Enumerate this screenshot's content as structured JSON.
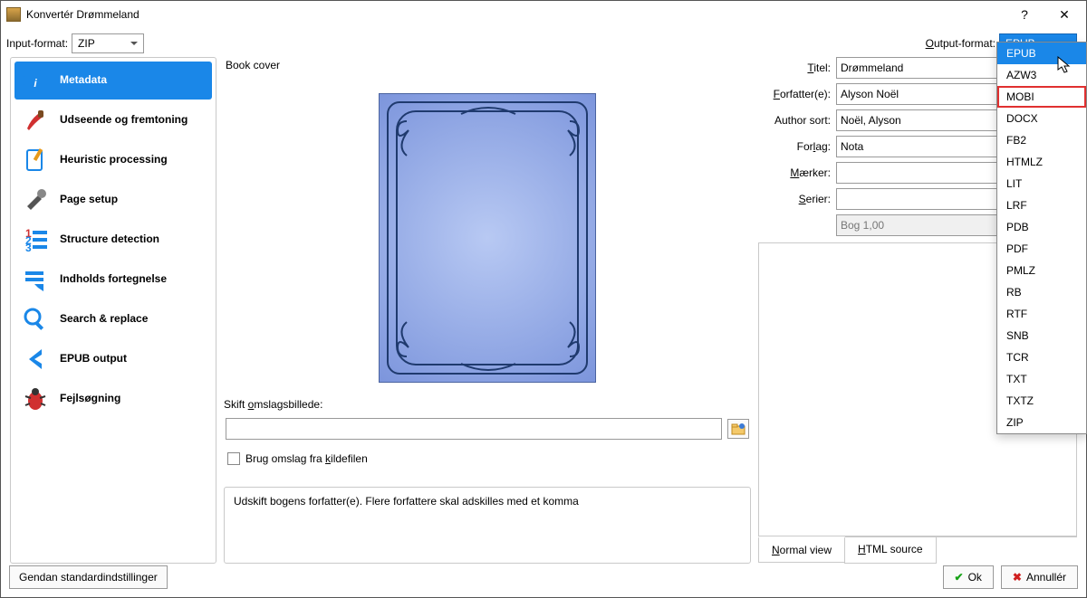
{
  "window": {
    "title": "Konvertér Drømmeland"
  },
  "input_format": {
    "label": "Input-format:",
    "value": "ZIP"
  },
  "output_format": {
    "label": "Output-format:",
    "value": "EPUB",
    "options": [
      "EPUB",
      "AZW3",
      "MOBI",
      "DOCX",
      "FB2",
      "HTMLZ",
      "LIT",
      "LRF",
      "PDB",
      "PDF",
      "PMLZ",
      "RB",
      "RTF",
      "SNB",
      "TCR",
      "TXT",
      "TXTZ",
      "ZIP"
    ],
    "selected": "EPUB",
    "highlighted": "MOBI"
  },
  "sidebar": {
    "items": [
      {
        "label": "Metadata",
        "icon": "info-icon",
        "active": true
      },
      {
        "label": "Udseende og fremtoning",
        "icon": "brush-icon"
      },
      {
        "label": "Heuristic processing",
        "icon": "wand-icon"
      },
      {
        "label": "Page setup",
        "icon": "tools-icon"
      },
      {
        "label": "Structure detection",
        "icon": "list-icon"
      },
      {
        "label": "Indholds fortegnelse",
        "icon": "toc-icon"
      },
      {
        "label": "Search & replace",
        "icon": "search-icon"
      },
      {
        "label": "EPUB output",
        "icon": "chevron-left-icon"
      },
      {
        "label": "Fejlsøgning",
        "icon": "bug-icon"
      }
    ]
  },
  "cover": {
    "heading": "Book cover",
    "change_label": "Skift omslagsbillede:",
    "use_source_cover": "Brug omslag fra kildefilen"
  },
  "form": {
    "title": {
      "label": "Titel:",
      "value": "Drømmeland"
    },
    "authors": {
      "label": "Forfatter(e):",
      "value": "Alyson Noël"
    },
    "author_sort": {
      "label": "Author sort:",
      "value": "Noël, Alyson"
    },
    "publisher": {
      "label": "Forlag:",
      "value": "Nota"
    },
    "tags": {
      "label": "Mærker:",
      "value": ""
    },
    "series": {
      "label": "Serier:",
      "value": ""
    },
    "series_index": {
      "value": "Bog 1,00"
    }
  },
  "views": {
    "normal": "Normal view",
    "html": "HTML source"
  },
  "hint": "Udskift bogens forfatter(e). Flere forfattere skal adskilles med et komma",
  "footer": {
    "restore": "Gendan standardindstillinger",
    "ok": "Ok",
    "cancel": "Annullér"
  }
}
